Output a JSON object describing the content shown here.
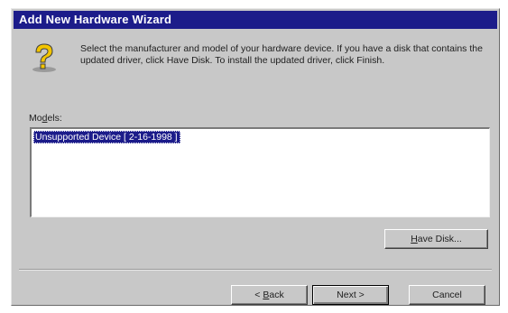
{
  "window": {
    "title": "Add New Hardware Wizard"
  },
  "instructions": "Select the manufacturer and model of your hardware device. If you have a disk that contains the updated driver, click Have Disk. To install the updated driver, click Finish.",
  "models": {
    "label_prefix": "Mo",
    "label_mnemonic": "d",
    "label_suffix": "els:",
    "items": [
      {
        "label": "Unsupported Device [ 2-16-1998 ]",
        "selected": true
      }
    ]
  },
  "buttons": {
    "have_disk": {
      "mnemonic": "H",
      "rest": "ave Disk..."
    },
    "back": {
      "prefix": "< ",
      "mnemonic": "B",
      "rest": "ack"
    },
    "next": {
      "label": "Next >"
    },
    "cancel": {
      "label": "Cancel"
    }
  },
  "icons": {
    "help": "question-mark-icon"
  },
  "colors": {
    "titlebar": "#1c1c8a",
    "selection": "#1c1c8a",
    "face": "#c8c8c8",
    "help_icon": "#f2c400"
  }
}
